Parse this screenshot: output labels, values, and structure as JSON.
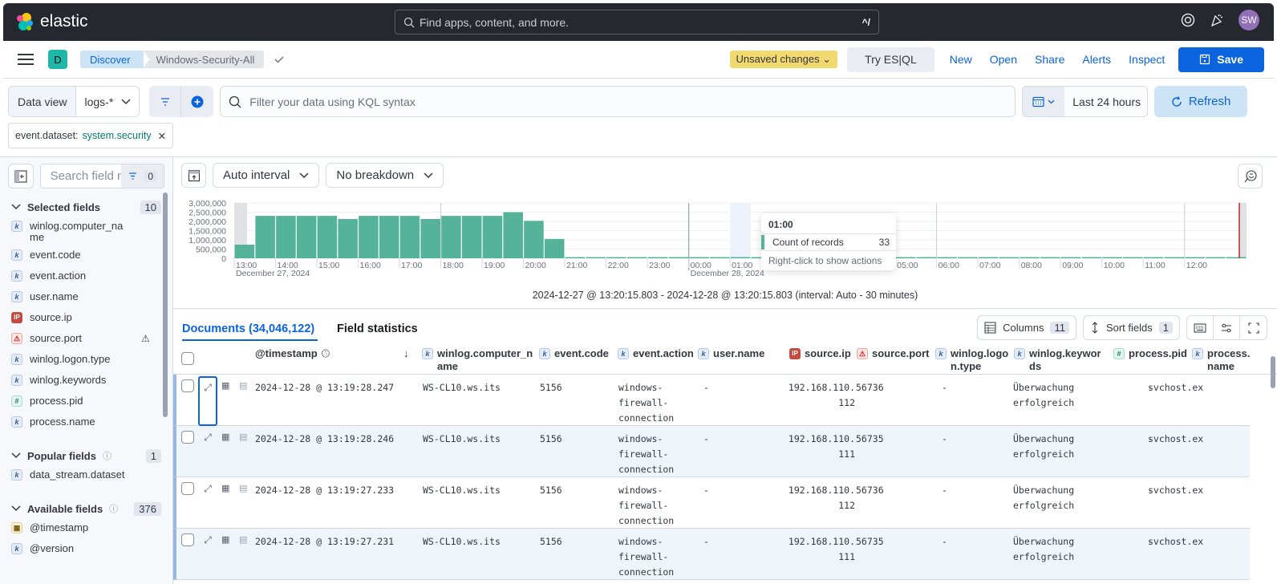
{
  "header": {
    "brand": "elastic",
    "search_placeholder": "Find apps, content, and more.",
    "search_shortcut": "^/",
    "avatar_initials": "SW"
  },
  "nav": {
    "space_initial": "D",
    "breadcrumbs": [
      "Discover",
      "Windows-Security-All"
    ],
    "unsaved_label": "Unsaved changes",
    "try_esql": "Try ES|QL",
    "links": [
      "New",
      "Open",
      "Share",
      "Alerts",
      "Inspect"
    ],
    "save_label": "Save"
  },
  "query": {
    "dataview_label": "Data view",
    "dataview_value": "logs-*",
    "kql_placeholder": "Filter your data using KQL syntax",
    "time_range": "Last 24 hours",
    "refresh_label": "Refresh",
    "filter_pill": {
      "field": "event.dataset:",
      "value": "system.security"
    }
  },
  "sidebar": {
    "search_placeholder": "Search field names",
    "filter_count": "0",
    "selected": {
      "title": "Selected fields",
      "count": "10",
      "items": [
        {
          "name": "winlog.computer_name",
          "type": "k"
        },
        {
          "name": "event.code",
          "type": "k"
        },
        {
          "name": "event.action",
          "type": "k"
        },
        {
          "name": "user.name",
          "type": "k"
        },
        {
          "name": "source.ip",
          "type": "ip"
        },
        {
          "name": "source.port",
          "type": "warn"
        },
        {
          "name": "winlog.logon.type",
          "type": "k"
        },
        {
          "name": "winlog.keywords",
          "type": "k"
        },
        {
          "name": "process.pid",
          "type": "num"
        },
        {
          "name": "process.name",
          "type": "k"
        }
      ]
    },
    "popular": {
      "title": "Popular fields",
      "count": "1",
      "items": [
        {
          "name": "data_stream.dataset",
          "type": "k"
        }
      ]
    },
    "available": {
      "title": "Available fields",
      "count": "376",
      "items": [
        {
          "name": "@timestamp",
          "type": "date"
        },
        {
          "name": "@version",
          "type": "k"
        }
      ]
    }
  },
  "chart_toolbar": {
    "interval": "Auto interval",
    "breakdown": "No breakdown"
  },
  "chart_data": {
    "type": "bar",
    "title": "",
    "xlabel": "",
    "ylabel": "Count of records",
    "ylim": [
      0,
      3000000
    ],
    "yticks": [
      "3,000,000",
      "2,500,000",
      "2,000,000",
      "1,500,000",
      "1,000,000",
      "500,000",
      "0"
    ],
    "xticks": [
      "13:00",
      "14:00",
      "15:00",
      "16:00",
      "17:00",
      "18:00",
      "19:00",
      "20:00",
      "21:00",
      "22:00",
      "23:00",
      "00:00",
      "01:00",
      "02:00",
      "03:00",
      "04:00",
      "05:00",
      "06:00",
      "07:00",
      "08:00",
      "09:00",
      "10:00",
      "11:00",
      "12:00"
    ],
    "date_labels": [
      {
        "at": "13:00",
        "label": "December 27, 2024"
      },
      {
        "at": "00:00",
        "label": "December 28, 2024"
      }
    ],
    "categories": [
      "13:00",
      "13:30",
      "14:00",
      "14:30",
      "15:00",
      "15:30",
      "16:00",
      "16:30",
      "17:00",
      "17:30",
      "18:00",
      "18:30",
      "19:00",
      "19:30",
      "20:00",
      "20:30",
      "21:00",
      "21:30",
      "22:00",
      "22:30",
      "23:00",
      "23:30",
      "00:00",
      "00:30",
      "01:00",
      "01:30",
      "02:00",
      "02:30",
      "03:00",
      "03:30",
      "04:00",
      "04:30",
      "05:00",
      "05:30",
      "06:00",
      "06:30",
      "07:00",
      "07:30",
      "08:00",
      "08:30",
      "09:00",
      "09:30",
      "10:00",
      "10:30",
      "11:00",
      "11:30",
      "12:00",
      "12:30",
      "13:00"
    ],
    "values": [
      740000,
      2300000,
      2300000,
      2300000,
      2300000,
      2130000,
      2300000,
      2300000,
      2300000,
      2130000,
      2300000,
      2300000,
      2300000,
      2500000,
      2030000,
      1050000,
      30000,
      40,
      40,
      40,
      40,
      40,
      40,
      40,
      33,
      40,
      40,
      40,
      40,
      40,
      40,
      40,
      40,
      40,
      40,
      40,
      40,
      40,
      40,
      40,
      40,
      40,
      40,
      40,
      40,
      40,
      40,
      40,
      40
    ],
    "tooltip": {
      "time": "01:00",
      "label": "Count of records",
      "value": "33",
      "hint": "Right-click to show actions"
    },
    "range_text": "2024-12-27 @ 13:20:15.803 - 2024-12-28 @ 13:20:15.803 (interval: Auto - 30 minutes)",
    "bar_color": "#54b399"
  },
  "documents": {
    "tab_label": "Documents (34,046,122)",
    "stats_tab": "Field statistics",
    "columns_label": "Columns",
    "columns_count": "11",
    "sort_label": "Sort fields",
    "sort_count": "1",
    "headers": [
      {
        "name": "@timestamp",
        "type": ""
      },
      {
        "name": "winlog.computer_name",
        "type": "k"
      },
      {
        "name": "event.code",
        "type": "k"
      },
      {
        "name": "event.action",
        "type": "k"
      },
      {
        "name": "user.name",
        "type": "k"
      },
      {
        "name": "source.ip",
        "type": "ip"
      },
      {
        "name": "source.port",
        "type": "warn"
      },
      {
        "name": "winlog.logon.type",
        "type": "k"
      },
      {
        "name": "winlog.keywords",
        "type": "k"
      },
      {
        "name": "process.pid",
        "type": "num"
      },
      {
        "name": "process.name",
        "type": "k"
      }
    ],
    "rows": [
      {
        "timestamp": "2024-12-28 @ 13:19:28.247",
        "computer": "WS-CL10.ws.its",
        "code": "5156",
        "action": "windows-\nfirewall-\nconnection",
        "user": "-",
        "ip": "192.168.110.\n112",
        "port": "56736",
        "logon": "-",
        "keywords": "Überwachung\nerfolgreich",
        "pid": "-",
        "process": "svchost.ex"
      },
      {
        "timestamp": "2024-12-28 @ 13:19:28.246",
        "computer": "WS-CL10.ws.its",
        "code": "5156",
        "action": "windows-\nfirewall-\nconnection",
        "user": "-",
        "ip": "192.168.110.\n111",
        "port": "56735",
        "logon": "-",
        "keywords": "Überwachung\nerfolgreich",
        "pid": "-",
        "process": "svchost.ex"
      },
      {
        "timestamp": "2024-12-28 @ 13:19:27.233",
        "computer": "WS-CL10.ws.its",
        "code": "5156",
        "action": "windows-\nfirewall-\nconnection",
        "user": "-",
        "ip": "192.168.110.\n112",
        "port": "56736",
        "logon": "-",
        "keywords": "Überwachung\nerfolgreich",
        "pid": "-",
        "process": "svchost.ex"
      },
      {
        "timestamp": "2024-12-28 @ 13:19:27.231",
        "computer": "WS-CL10.ws.its",
        "code": "5156",
        "action": "windows-\nfirewall-\nconnection",
        "user": "-",
        "ip": "192.168.110.\n111",
        "port": "56735",
        "logon": "-",
        "keywords": "Überwachung\nerfolgreich",
        "pid": "-",
        "process": "svchost.ex"
      }
    ]
  }
}
